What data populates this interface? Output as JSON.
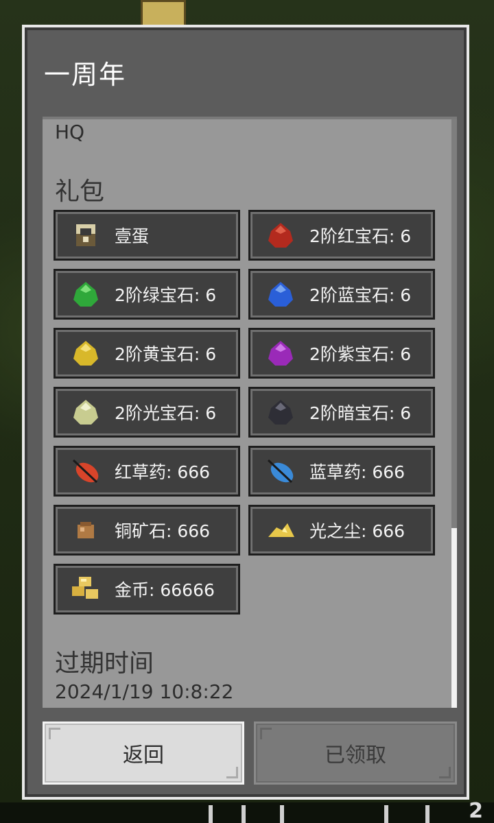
{
  "dialog": {
    "title": "一周年",
    "code": "HQ",
    "gift_heading": "礼包",
    "items": [
      {
        "label": "壹蛋",
        "icon": "egg-icon",
        "color": "#6b5a3a"
      },
      {
        "label": "2阶红宝石: 6",
        "icon": "red-gem-icon",
        "color": "#b32a1e"
      },
      {
        "label": "2阶绿宝石: 6",
        "icon": "green-gem-icon",
        "color": "#2fa83a"
      },
      {
        "label": "2阶蓝宝石: 6",
        "icon": "blue-gem-icon",
        "color": "#2a5fd8"
      },
      {
        "label": "2阶黄宝石: 6",
        "icon": "yellow-gem-icon",
        "color": "#d8b82a"
      },
      {
        "label": "2阶紫宝石: 6",
        "icon": "purple-gem-icon",
        "color": "#9a2ab8"
      },
      {
        "label": "2阶光宝石: 6",
        "icon": "light-gem-icon",
        "color": "#d8dca0"
      },
      {
        "label": "2阶暗宝石: 6",
        "icon": "dark-gem-icon",
        "color": "#3a3a44"
      },
      {
        "label": "红草药: 666",
        "icon": "red-herb-icon",
        "color": "#d8442a"
      },
      {
        "label": "蓝草药: 666",
        "icon": "blue-herb-icon",
        "color": "#3a8ad8"
      },
      {
        "label": "铜矿石: 666",
        "icon": "copper-ore-icon",
        "color": "#b07a44"
      },
      {
        "label": "光之尘: 666",
        "icon": "light-dust-icon",
        "color": "#e8c84a"
      },
      {
        "label": "金币: 66666",
        "icon": "gold-coin-icon",
        "color": "#e8c860"
      }
    ],
    "expire_heading": "过期时间",
    "expire_time": "2024/1/19 10:8:22",
    "back_label": "返回",
    "claimed_label": "已领取"
  },
  "background": {
    "bottom_number": "2"
  }
}
